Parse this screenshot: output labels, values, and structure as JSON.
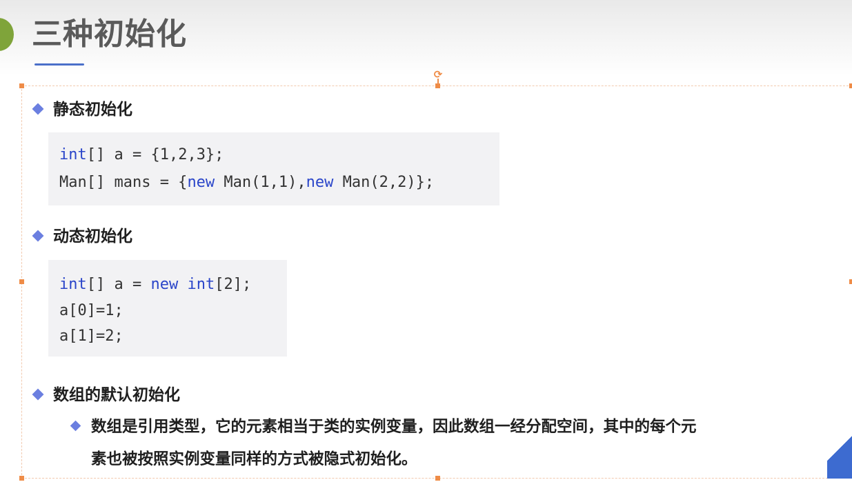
{
  "slide": {
    "title": "三种初始化",
    "sections": [
      {
        "heading": "静态初始化",
        "code": [
          [
            {
              "t": "int",
              "kw": true
            },
            {
              "t": "[] a = {1,2,3};",
              "kw": false
            }
          ],
          [
            {
              "t": "Man[] mans = {",
              "kw": false
            },
            {
              "t": "new",
              "kw": true
            },
            {
              "t": " Man(1,1),",
              "kw": false
            },
            {
              "t": "new",
              "kw": true
            },
            {
              "t": " Man(2,2)};",
              "kw": false
            }
          ]
        ]
      },
      {
        "heading": "动态初始化",
        "code": [
          [
            {
              "t": "int",
              "kw": true
            },
            {
              "t": "[] a = ",
              "kw": false
            },
            {
              "t": "new",
              "kw": true
            },
            {
              "t": " ",
              "kw": false
            },
            {
              "t": "int",
              "kw": true
            },
            {
              "t": "[2];",
              "kw": false
            }
          ],
          [
            {
              "t": "a[0]=1;",
              "kw": false
            }
          ],
          [
            {
              "t": "a[1]=2;",
              "kw": false
            }
          ]
        ]
      },
      {
        "heading": "数组的默认初始化",
        "sub_bullet": {
          "line1": "数组是引用类型，它的元素相当于类的实例变量，因此数组一经分配空间，其中的每个元",
          "line2": "素也被按照实例变量同样的方式被隐式初始化。"
        }
      }
    ]
  },
  "colors": {
    "accent_green": "#7fa43a",
    "title_underline": "#4a6fc9",
    "bullet": "#6b7fe0",
    "keyword": "#2a45c9",
    "selection_handle": "#ef8c47",
    "corner_shape": "#4e79d4"
  },
  "icons": {
    "rotate_handle": "rotate-icon",
    "bullet": "diamond-bullet-icon"
  }
}
